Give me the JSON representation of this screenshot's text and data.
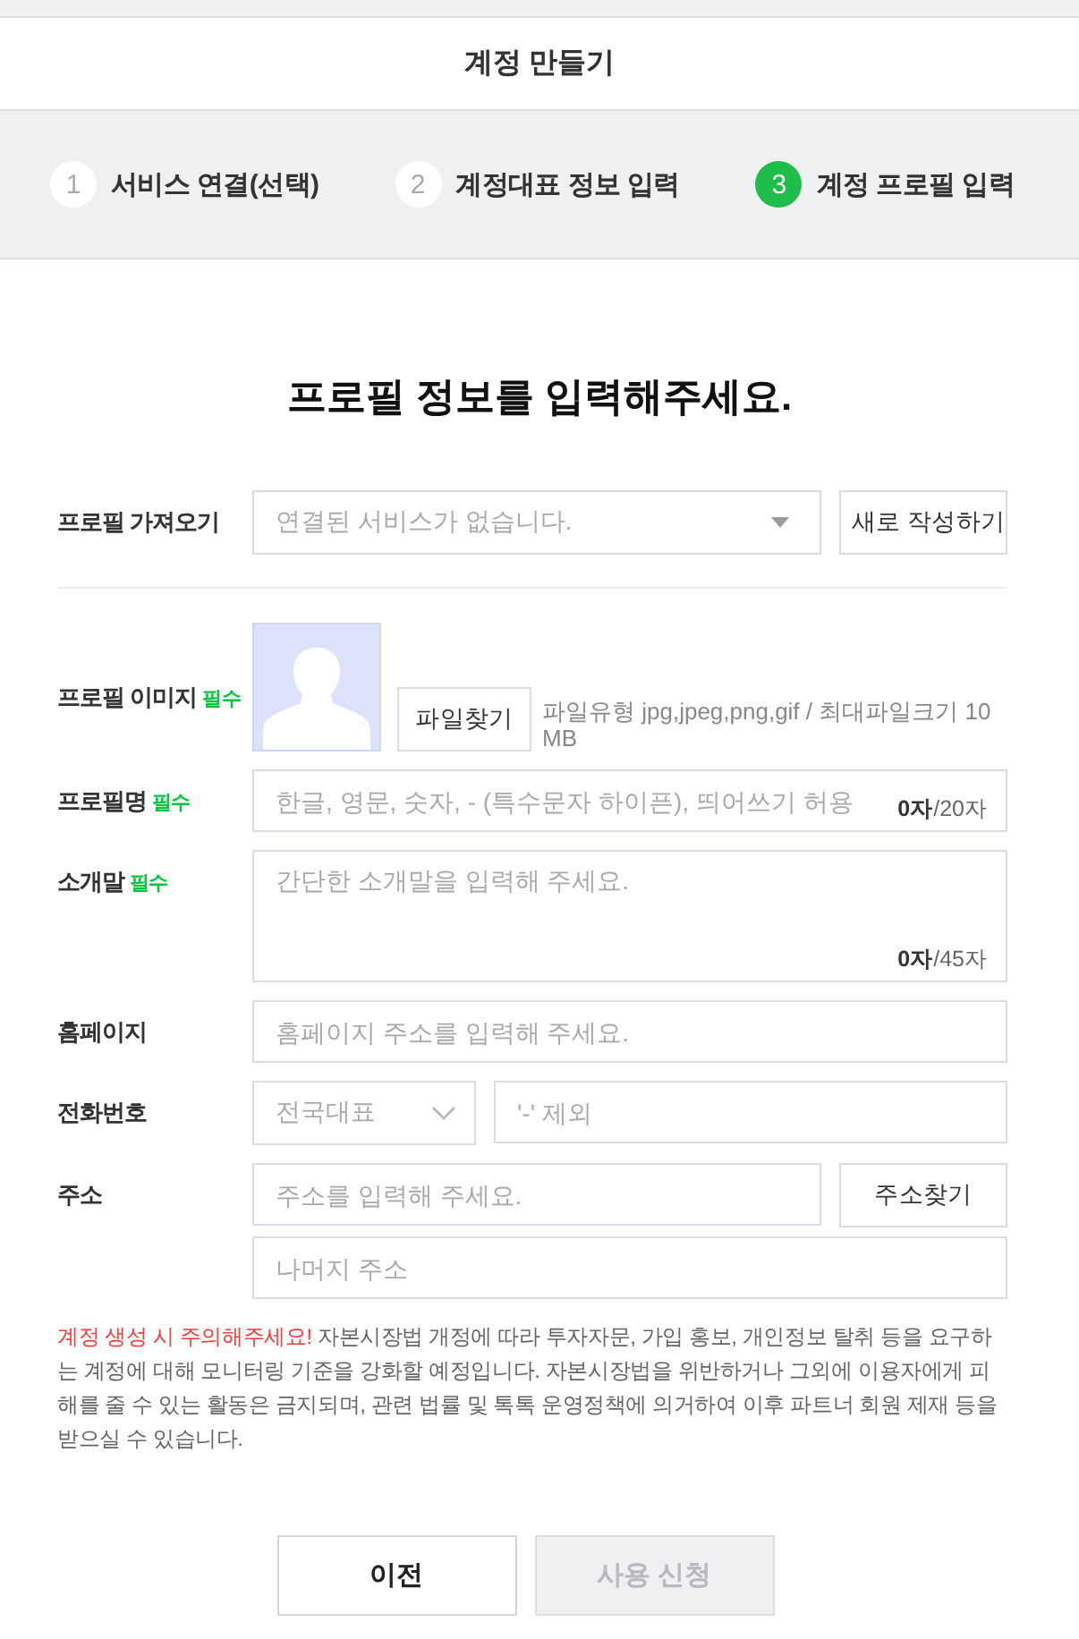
{
  "header": {
    "title": "계정 만들기"
  },
  "steps": [
    {
      "number": "1",
      "label": "서비스 연결(선택)",
      "selected": false
    },
    {
      "number": "2",
      "label": "계정대표 정보 입력",
      "selected": false
    },
    {
      "number": "3",
      "label": "계정 프로필 입력",
      "selected": true
    }
  ],
  "heading": "프로필 정보를 입력해주세요.",
  "import_row": {
    "label": "프로필 가져오기",
    "select": {
      "value": "연결된 서비스가 없습니다."
    },
    "button": "새로 작성하기"
  },
  "fields": [
    {
      "kind": "image",
      "label": "프로필 이미지",
      "required_badge": "필수",
      "button": "파일찾기",
      "hint": "파일유형 jpg,jpeg,png,gif / 최대파일크기 10MB"
    },
    {
      "kind": "text",
      "label": "프로필명",
      "required_badge": "필수",
      "placeholder": "한글, 영문, 숫자, - (특수문자 하이픈), 띄어쓰기 허용",
      "counter": "**0자**/20자"
    },
    {
      "kind": "textarea",
      "label": "소개말",
      "required_badge": "필수",
      "placeholder": "간단한 소개말을 입력해 주세요.",
      "counter": "**0자**/45자"
    },
    {
      "kind": "text",
      "label": "홈페이지",
      "placeholder": "홈페이지 주소를 입력해 주세요."
    },
    {
      "kind": "phone",
      "label": "전화번호",
      "select": {
        "value": "전국대표"
      },
      "placeholder": "'-' 제외"
    },
    {
      "kind": "address",
      "label": "주소",
      "placeholder": "주소를 입력해 주세요.",
      "button": "주소찾기",
      "detail_placeholder": "나머지 주소"
    }
  ],
  "notice": {
    "highlight": "계정 생성 시 주의해주세요!",
    "text": "자본시장법 개정에 따라 투자자문, 가입 홍보, 개인정보 탈취 등을 요구하는 계정에 대해 모니터링 기준을 강화할 예정입니다. 자본시장법을 위반하거나 그외에 이용자에게 피해를 줄 수 있는 활동은 금지되며, 관련 법률 및 톡톡 운영정책에 의거하여 이후 파트너 회원 제재 등을 받으실 수 있습니다."
  },
  "buttons": [
    {
      "label": "이전",
      "disabled": false
    },
    {
      "label": "사용 신청",
      "disabled": true
    }
  ]
}
